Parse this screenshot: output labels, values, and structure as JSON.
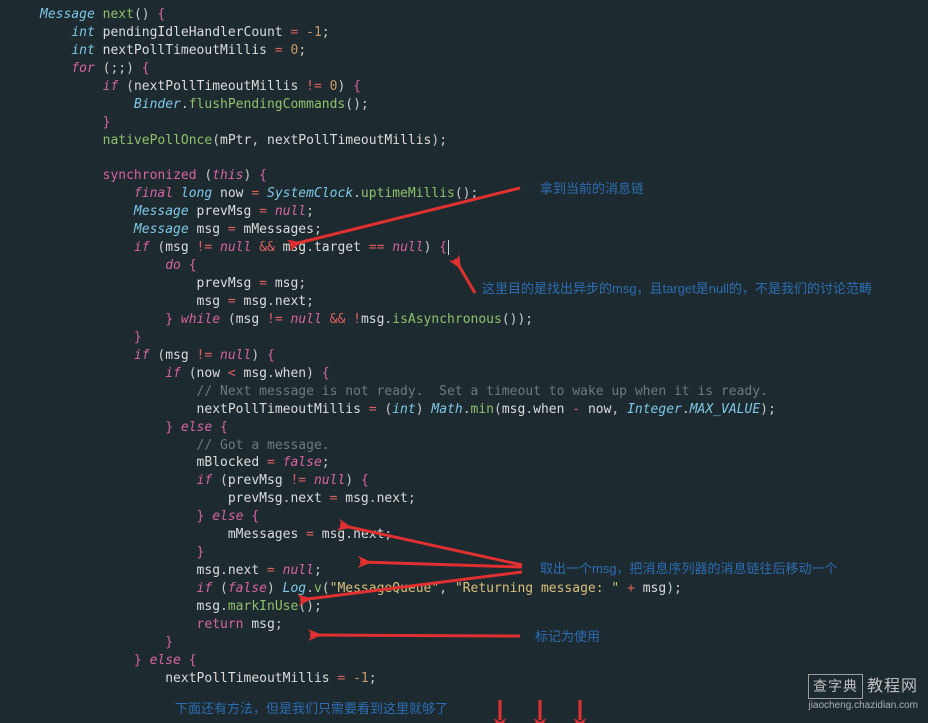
{
  "code": {
    "sig_type": "Message",
    "sig_name": "next",
    "int_kw": "int",
    "for_kw": "for",
    "if_kw": "if",
    "else_kw": "else",
    "do_kw": "do",
    "while_kw": "while",
    "return_kw": "return",
    "sync_kw": "synchronized",
    "this_kw": "this",
    "final_kw": "final",
    "long_kw": "long",
    "null_kw": "null",
    "false_kw": "false",
    "var_pending": "pendingIdleHandlerCount",
    "var_nextPoll": "nextPollTimeoutMillis",
    "Binder": "Binder",
    "flushPendingCommands": "flushPendingCommands",
    "nativePollOnce": "nativePollOnce",
    "mPtr": "mPtr",
    "now": "now",
    "SystemClock": "SystemClock",
    "uptimeMillis": "uptimeMillis",
    "Message": "Message",
    "prevMsg": "prevMsg",
    "msg": "msg",
    "mMessages": "mMessages",
    "target": "target",
    "next": "next",
    "isAsynchronous": "isAsynchronous",
    "when": "when",
    "Math": "Math",
    "min": "min",
    "Integer": "Integer",
    "MAX_VALUE": "MAX_VALUE",
    "mBlocked": "mBlocked",
    "Log": "Log",
    "v": "v",
    "markInUse": "markInUse",
    "n_neg1": "-1",
    "n_0": "0",
    "cmt_notready": "// Next message is not ready.  Set a timeout to wake up when it is ready.",
    "cmt_got": "// Got a message.",
    "str_mq": "\"MessageQueue\"",
    "str_ret": "\"Returning message: \""
  },
  "annotations": {
    "a1": "拿到当前的消息链",
    "a2": "这里目的是找出异步的msg，且target是null的，不是我们的讨论范畴",
    "a3": "取出一个msg，把消息序列器的消息链往后移动一个",
    "a4": "标记为使用",
    "a5": "下面还有方法，但是我们只需要看到这里就够了"
  },
  "watermark": {
    "brand": "查字典",
    "suffix": "教程网",
    "url": "jiaocheng.chazidian.com"
  }
}
